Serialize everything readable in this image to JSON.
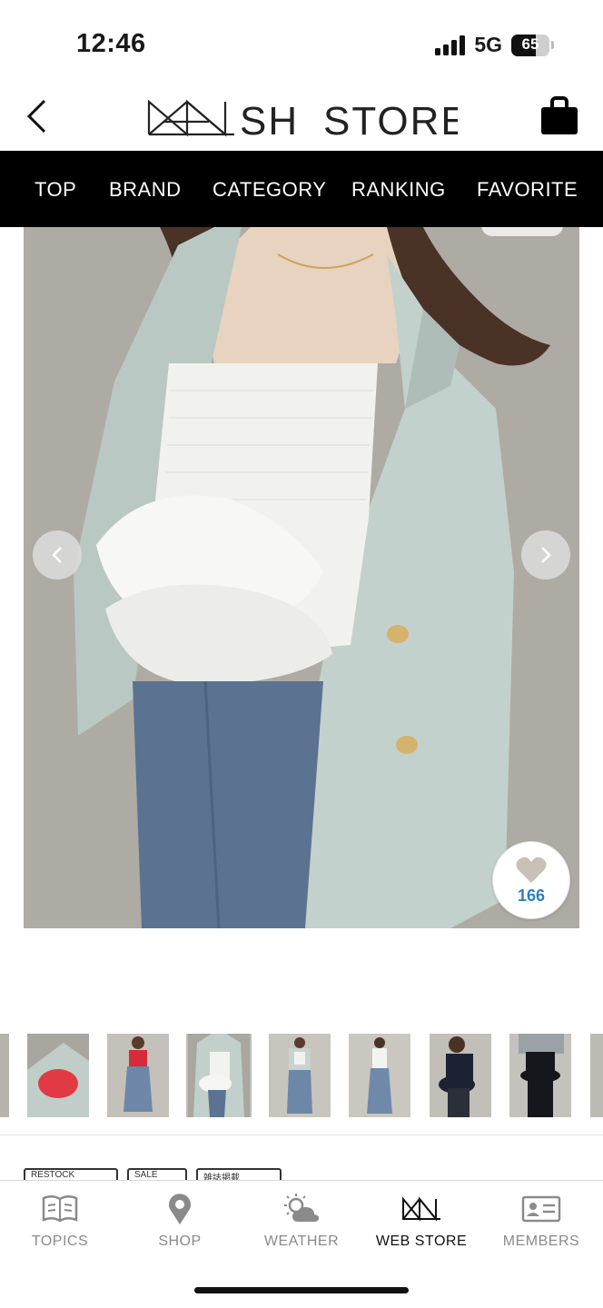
{
  "status_bar": {
    "time": "12:46",
    "network": "5G",
    "battery": "65",
    "battery_level": 0.65
  },
  "header": {
    "logo_text": "MASH STORE",
    "back_icon": "chevron-left-icon",
    "cart_icon": "shopping-bag-icon"
  },
  "nav": {
    "items": [
      {
        "label": "TOP"
      },
      {
        "label": "BRAND"
      },
      {
        "label": "CATEGORY"
      },
      {
        "label": "RANKING"
      },
      {
        "label": "FAVORITE"
      }
    ]
  },
  "product": {
    "favorite_count": "166",
    "favorite_icon": "heart-icon",
    "gallery_count": 9,
    "active_index": 3
  },
  "tags_peek": [
    "RESTOCK",
    "SALE",
    "雑誌掲載"
  ],
  "tabbar": {
    "items": [
      {
        "label": "TOPICS",
        "icon": "book-icon",
        "active": false
      },
      {
        "label": "SHOP",
        "icon": "map-pin-icon",
        "active": false
      },
      {
        "label": "WEATHER",
        "icon": "weather-icon",
        "active": false
      },
      {
        "label": "WEB STORE",
        "icon": "web-store-icon",
        "active": true
      },
      {
        "label": "MEMBERS",
        "icon": "member-card-icon",
        "active": false
      }
    ]
  },
  "colors": {
    "nav_bg": "#000000",
    "accent_count": "#2b7fc2",
    "tab_inactive": "#8a8a8a"
  }
}
